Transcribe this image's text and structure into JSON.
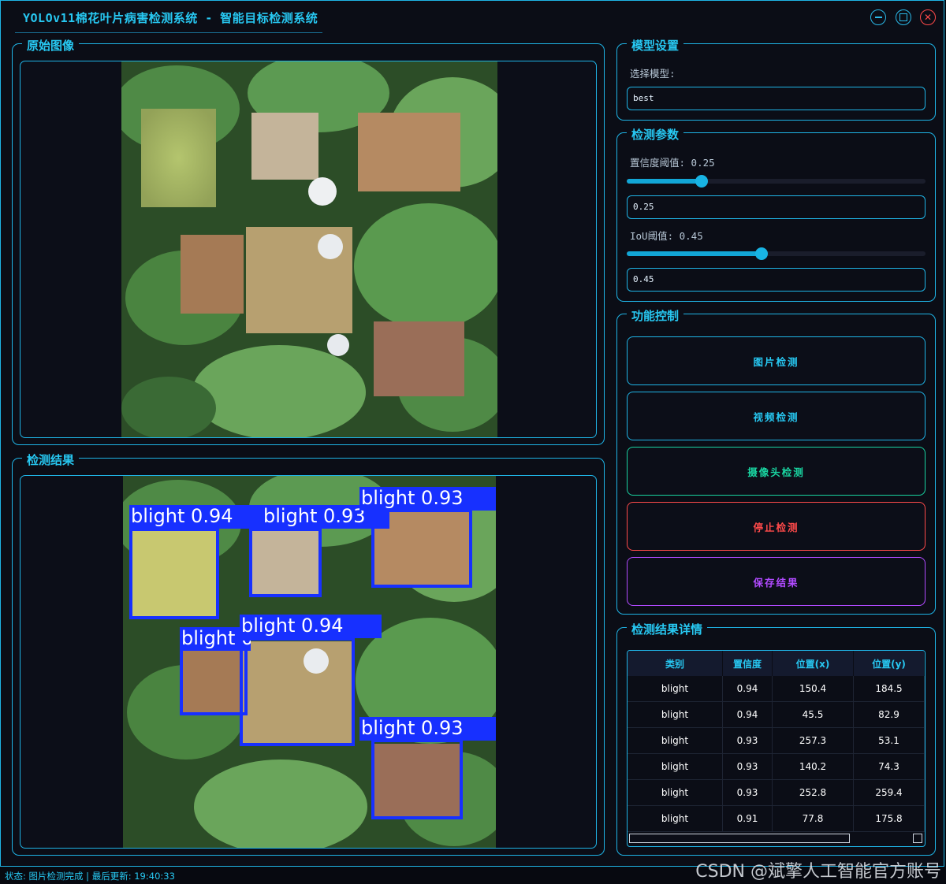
{
  "window": {
    "title": "YOLOv11棉花叶片病害检测系统 - 智能目标检测系统"
  },
  "panels": {
    "original_title": "原始图像",
    "result_title": "检测结果"
  },
  "model_settings": {
    "title": "模型设置",
    "select_label": "选择模型:",
    "selected_model": "best"
  },
  "detection_params": {
    "title": "检测参数",
    "conf_label": "置信度阈值: 0.25",
    "conf_value": "0.25",
    "conf_level": 0.25,
    "iou_label": "IoU阈值: 0.45",
    "iou_value": "0.45",
    "iou_level": 0.45
  },
  "controls": {
    "title": "功能控制",
    "image_detect": "图片检测",
    "video_detect": "视频检测",
    "camera_detect": "摄像头检测",
    "stop_detect": "停止检测",
    "save_results": "保存结果",
    "colors": {
      "image_detect": "#1fb4e6",
      "video_detect": "#1fb4e6",
      "camera_detect": "#19d3a0",
      "stop_detect": "#ff4a4a",
      "save_results": "#b14aff"
    }
  },
  "results_detail": {
    "title": "检测结果详情",
    "columns": [
      "类别",
      "置信度",
      "位置(x)",
      "位置(y)"
    ],
    "rows": [
      [
        "blight",
        "0.94",
        "150.4",
        "184.5"
      ],
      [
        "blight",
        "0.94",
        "45.5",
        "82.9"
      ],
      [
        "blight",
        "0.93",
        "257.3",
        "53.1"
      ],
      [
        "blight",
        "0.93",
        "140.2",
        "74.3"
      ],
      [
        "blight",
        "0.93",
        "252.8",
        "259.4"
      ],
      [
        "blight",
        "0.91",
        "77.8",
        "175.8"
      ]
    ]
  },
  "detections_overlay": [
    "blight 0.94",
    "blight 0.93",
    "blight 0.93",
    "blight 0.91",
    "blight 0.94",
    "blight 0.93"
  ],
  "status": {
    "text": "状态: 图片检测完成 | 最后更新: 19:40:33"
  },
  "watermark": "CSDN @斌擎人工智能官方账号"
}
